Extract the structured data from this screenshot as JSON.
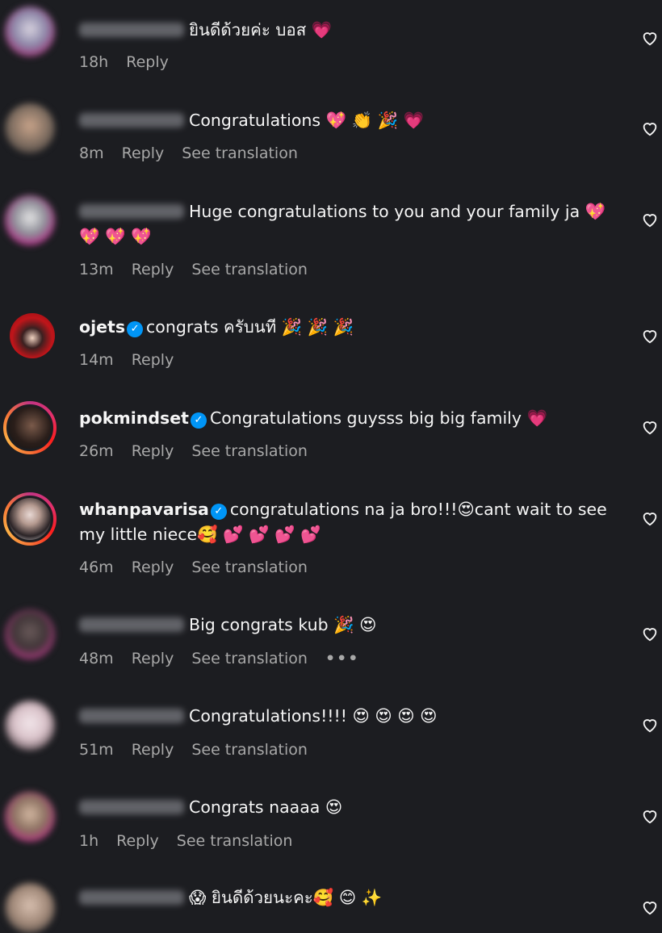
{
  "labels": {
    "reply": "Reply",
    "see_translation": "See translation",
    "more": "•••"
  },
  "comments": [
    {
      "user": "",
      "text": "ยินดีด้วยค่ะ บอส 💗",
      "time": "18h"
    },
    {
      "user": "",
      "text": "Congratulations 💖 👏 🎉 💗",
      "time": "8m"
    },
    {
      "user": "",
      "text": "Huge congratulations to you and your family ja 💖 💖 💖 💖",
      "time": "13m"
    },
    {
      "user": "ojets",
      "text": "congrats ครับนที 🎉 🎉 🎉",
      "time": "14m"
    },
    {
      "user": "pokmindset",
      "text": "Congratulations guysss big big family 💗",
      "time": "26m"
    },
    {
      "user": "whanpavarisa",
      "text": "congratulations na ja bro!!!😍cant wait to see my little niece🥰 💕 💕 💕 💕",
      "time": "46m"
    },
    {
      "user": "",
      "text": "Big congrats kub 🎉 😍",
      "time": "48m"
    },
    {
      "user": "",
      "text": "Congratulations!!!! 😍 😍 😍 😍",
      "time": "51m"
    },
    {
      "user": "",
      "text": "Congrats naaaa 😍",
      "time": "1h"
    },
    {
      "user": "",
      "text": "😱 ยินดีด้วยนะคะ🥰 😊 ✨",
      "time": ""
    }
  ],
  "colors": {
    "background": "#1c1d21",
    "verified": "#0095f6",
    "meta": "#a8a8a8"
  }
}
